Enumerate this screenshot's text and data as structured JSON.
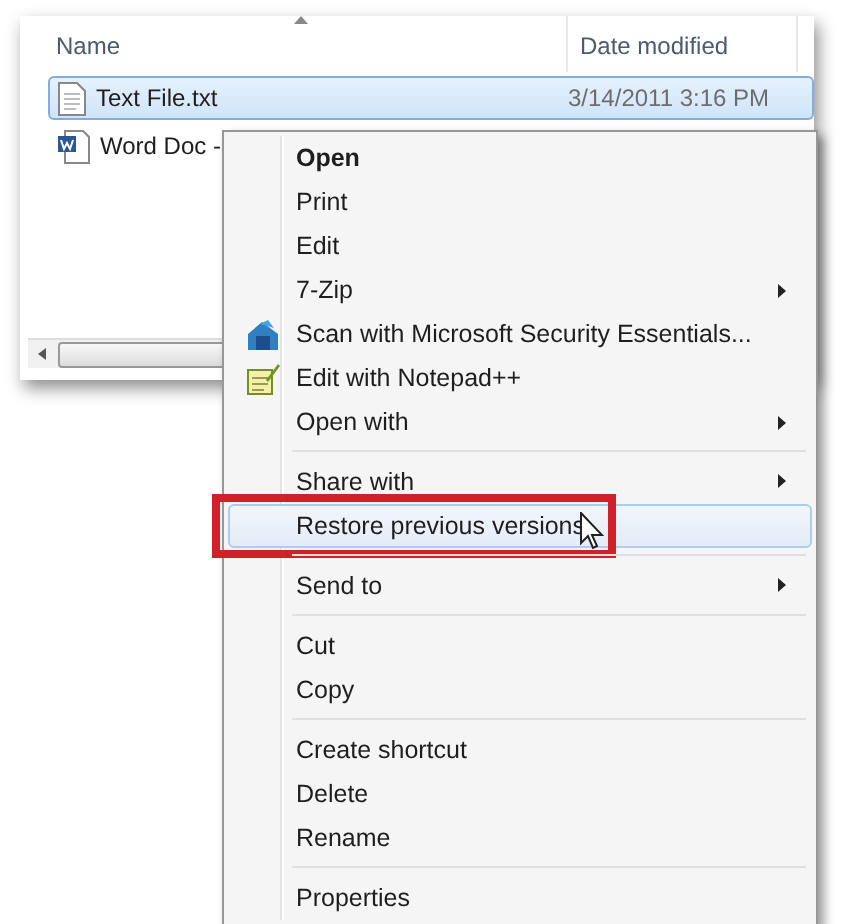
{
  "file_list": {
    "columns": [
      {
        "label": "Name",
        "sorted": true
      },
      {
        "label": "Date modified",
        "sorted": false
      }
    ],
    "rows": [
      {
        "name": "Text File.txt",
        "date": "3/14/2011 3:16 PM",
        "kind": "text",
        "selected": true
      },
      {
        "name": "Word Doc -",
        "kind": "document",
        "selected": false
      }
    ]
  },
  "context_menu": {
    "items": [
      {
        "label": "Open",
        "default": true,
        "submenu": false,
        "separator_before": false,
        "selected": false
      },
      {
        "label": "Print",
        "default": false,
        "submenu": false,
        "separator_before": false,
        "selected": false
      },
      {
        "label": "Edit",
        "default": false,
        "submenu": false,
        "separator_before": false,
        "selected": false
      },
      {
        "label": "7-Zip",
        "default": false,
        "submenu": true,
        "separator_before": false,
        "selected": false
      },
      {
        "label": "Scan with Microsoft Security Essentials...",
        "kind": "scan",
        "default": false,
        "submenu": false,
        "separator_before": false,
        "selected": false
      },
      {
        "label": "Edit with Notepad++",
        "kind": "notepad",
        "default": false,
        "submenu": false,
        "separator_before": false,
        "selected": false
      },
      {
        "label": "Open with",
        "default": false,
        "submenu": true,
        "separator_before": false,
        "selected": false
      },
      {
        "label": "Share with",
        "default": false,
        "submenu": true,
        "separator_before": true,
        "selected": false
      },
      {
        "label": "Restore previous versions",
        "default": false,
        "submenu": false,
        "separator_before": false,
        "selected": true,
        "outlined": true
      },
      {
        "label": "Send to",
        "default": false,
        "submenu": true,
        "separator_before": true,
        "selected": false
      },
      {
        "label": "Cut",
        "default": false,
        "submenu": false,
        "separator_before": true,
        "selected": false
      },
      {
        "label": "Copy",
        "default": false,
        "submenu": false,
        "separator_before": false,
        "selected": false
      },
      {
        "label": "Create shortcut",
        "default": false,
        "submenu": false,
        "separator_before": true,
        "selected": false
      },
      {
        "label": "Delete",
        "default": false,
        "submenu": false,
        "separator_before": false,
        "selected": false
      },
      {
        "label": "Rename",
        "default": false,
        "submenu": false,
        "separator_before": false,
        "selected": false
      },
      {
        "label": "Properties",
        "default": false,
        "submenu": false,
        "separator_before": true,
        "selected": false
      }
    ]
  }
}
